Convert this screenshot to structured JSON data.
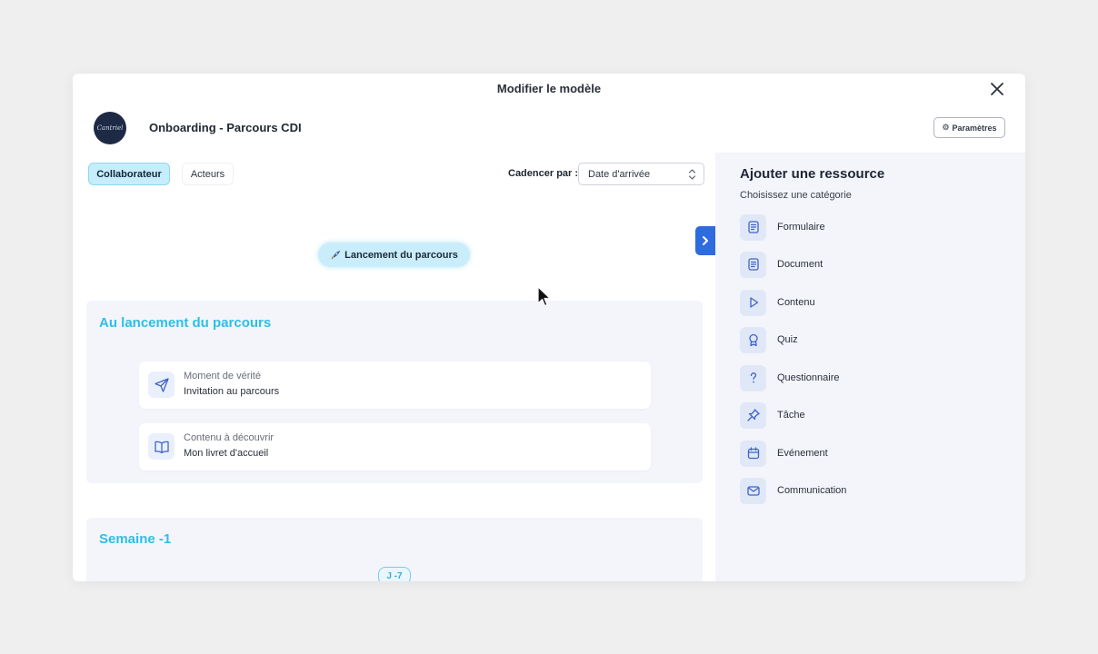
{
  "modal": {
    "title": "Modifier le modèle"
  },
  "header": {
    "logo_text": "Cantriel",
    "program_name": "Onboarding - Parcours CDI",
    "params_label": "Paramètres"
  },
  "tabs": [
    {
      "label": "Collaborateur",
      "active": true
    },
    {
      "label": "Acteurs",
      "active": false
    }
  ],
  "cadence": {
    "label": "Cadencer par :",
    "value": "Date d'arrivée"
  },
  "launch": {
    "label": "Lancement du parcours",
    "icon": "rocket-icon"
  },
  "sections": [
    {
      "title": "Au lancement du parcours",
      "cards": [
        {
          "category": "Moment de vérité",
          "title": "Invitation au parcours",
          "icon": "send-icon"
        },
        {
          "category": "Contenu à découvrir",
          "title": "Mon livret d'accueil",
          "icon": "book-icon"
        }
      ]
    },
    {
      "title": "Semaine -1",
      "badge": "J -7"
    }
  ],
  "resource_panel": {
    "title": "Ajouter une ressource",
    "subtitle": "Choisissez une catégorie",
    "items": [
      {
        "label": "Formulaire",
        "icon": "form-icon"
      },
      {
        "label": "Document",
        "icon": "document-icon"
      },
      {
        "label": "Contenu",
        "icon": "play-icon"
      },
      {
        "label": "Quiz",
        "icon": "award-icon"
      },
      {
        "label": "Questionnaire",
        "icon": "question-icon"
      },
      {
        "label": "Tâche",
        "icon": "pin-icon"
      },
      {
        "label": "Evénement",
        "icon": "calendar-icon"
      },
      {
        "label": "Communication",
        "icon": "mail-icon"
      }
    ]
  },
  "colors": {
    "accent_blue": "#2f6be0",
    "section_title": "#2ebee8",
    "active_tab_bg": "#c6edfb",
    "panel_bg": "#f3f5fb",
    "icon_stroke": "#3f63c6"
  }
}
